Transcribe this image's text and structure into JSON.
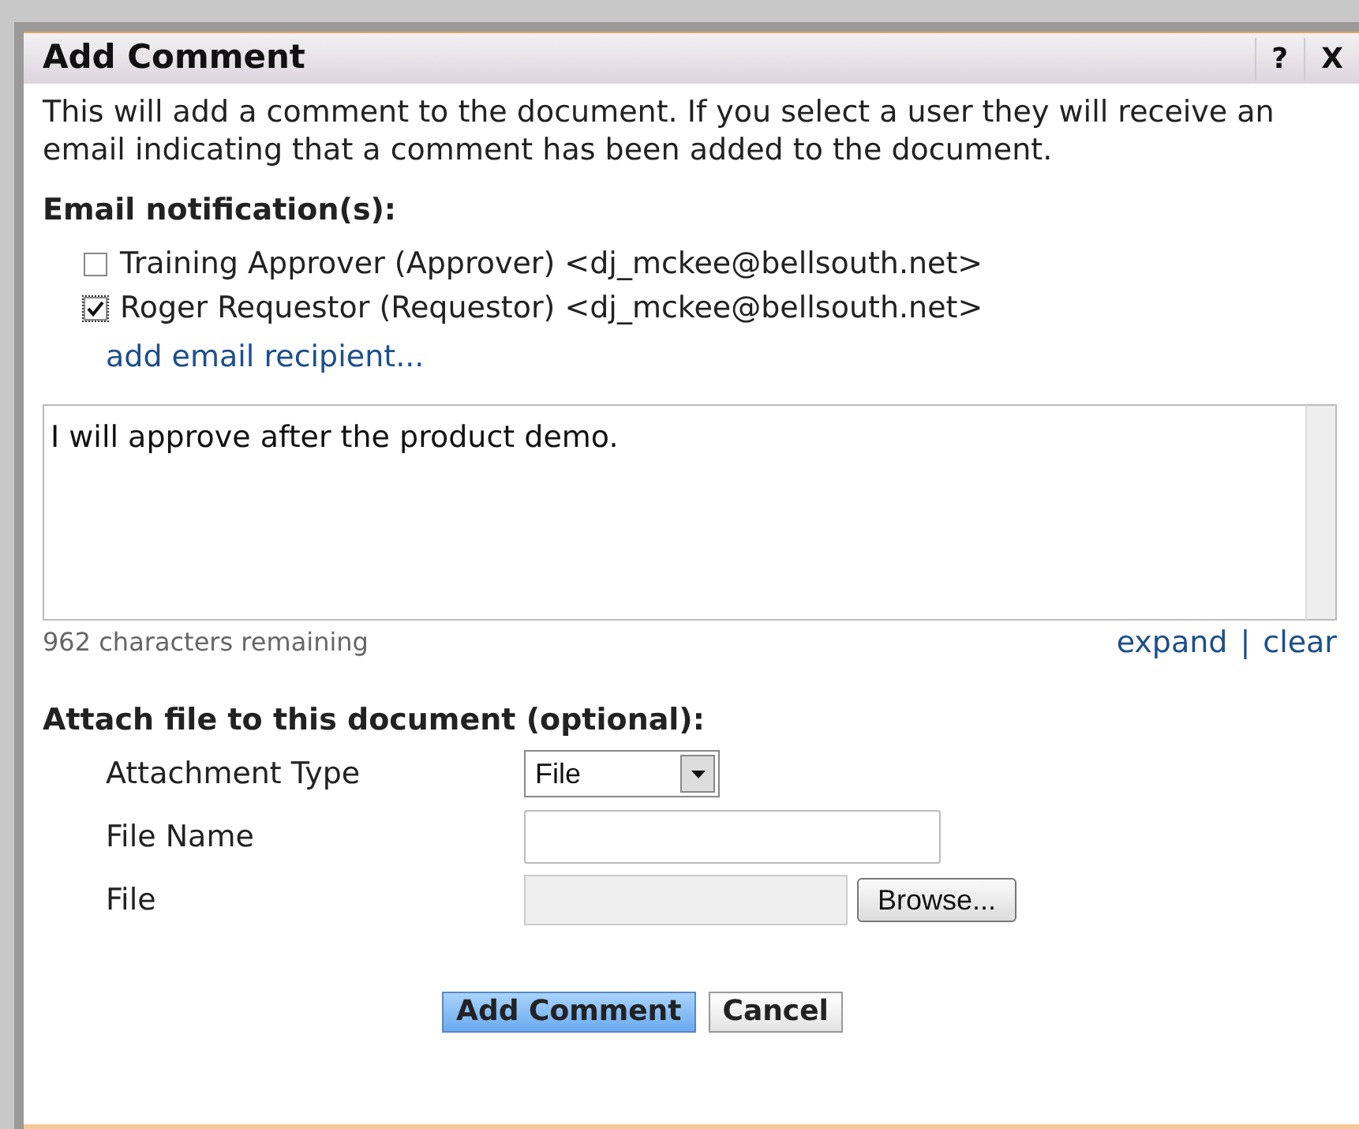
{
  "dialog": {
    "title": "Add Comment",
    "help": "?",
    "close": "X"
  },
  "intro": "This will add a comment to the document. If you select a user they will receive an email indicating that a comment has been added to the document.",
  "notifications": {
    "heading": "Email notification(s):",
    "recipients": [
      {
        "label": "Training Approver (Approver) <dj_mckee@bellsouth.net>",
        "checked": false
      },
      {
        "label": "Roger Requestor (Requestor) <dj_mckee@bellsouth.net>",
        "checked": true
      }
    ],
    "add_link": "add email recipient..."
  },
  "comment": {
    "value": "I will approve after the product demo.",
    "remaining": "962 characters remaining",
    "expand": "expand",
    "separator": "|",
    "clear": "clear"
  },
  "attach": {
    "heading": "Attach file to this document (optional):",
    "fields": [
      {
        "kind": "select",
        "label": "Attachment Type",
        "value": "File"
      },
      {
        "kind": "text",
        "label": "File Name"
      },
      {
        "kind": "file",
        "label": "File",
        "button": "Browse..."
      }
    ]
  },
  "buttons": [
    {
      "label": "Add Comment",
      "primary": true
    },
    {
      "label": "Cancel",
      "primary": false
    }
  ]
}
